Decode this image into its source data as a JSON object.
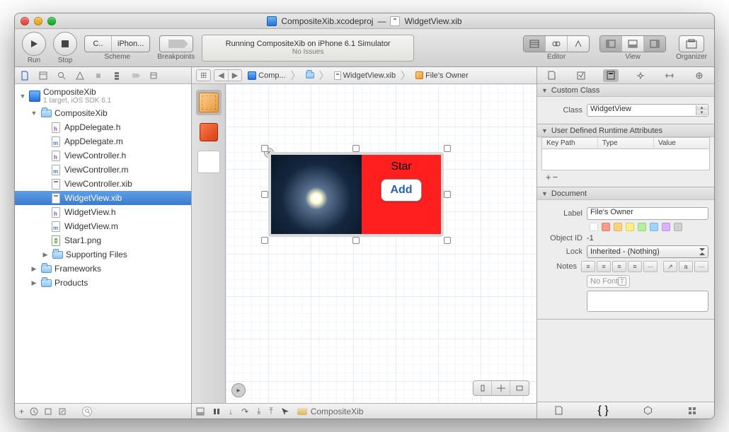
{
  "titlebar": {
    "project": "CompositeXib.xcodeproj",
    "file": "WidgetView.xib"
  },
  "toolbar": {
    "run": "Run",
    "stop": "Stop",
    "scheme": {
      "target": "C..",
      "dest": "iPhon...",
      "label": "Scheme"
    },
    "breakpoints": "Breakpoints",
    "lcd": {
      "line1": "Running CompositeXib on iPhone 6.1 Simulator",
      "line2": "No Issues"
    },
    "editor": "Editor",
    "view": "View",
    "organizer": "Organizer"
  },
  "navigator": {
    "project": "CompositeXib",
    "subtitle": "1 target, iOS SDK 6.1",
    "items": [
      "CompositeXib",
      "AppDelegate.h",
      "AppDelegate.m",
      "ViewController.h",
      "ViewController.m",
      "ViewController.xib",
      "WidgetView.xib",
      "WidgetView.h",
      "WidgetView.m",
      "Star1.png",
      "Supporting Files",
      "Frameworks",
      "Products"
    ]
  },
  "jumpbar": [
    "Comp...",
    "WidgetView.xib",
    "File's Owner"
  ],
  "canvas": {
    "label": "Star",
    "button": "Add"
  },
  "debug": {
    "process": "CompositeXib"
  },
  "inspector": {
    "customClass": {
      "title": "Custom Class",
      "classLabel": "Class",
      "className": "WidgetView"
    },
    "runtime": {
      "title": "User Defined Runtime Attributes",
      "cols": [
        "Key Path",
        "Type",
        "Value"
      ]
    },
    "document": {
      "title": "Document",
      "labelLbl": "Label",
      "labelVal": "File's Owner",
      "objectIdLbl": "Object ID",
      "objectId": "-1",
      "lockLbl": "Lock",
      "lockVal": "Inherited - (Nothing)",
      "notesLbl": "Notes",
      "fontPlaceholder": "No Font"
    }
  }
}
